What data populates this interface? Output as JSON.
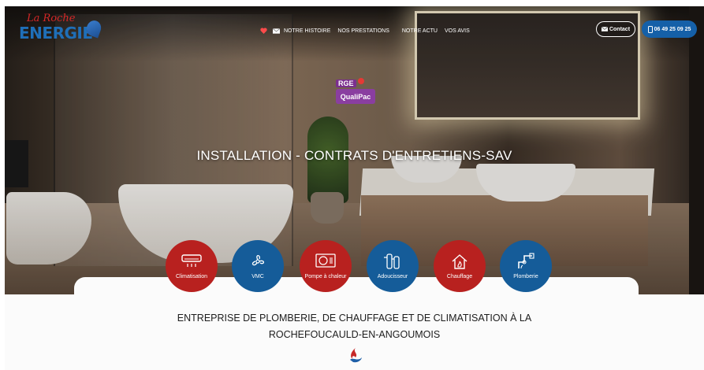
{
  "brand": {
    "logo_line1": "La Roche",
    "logo_line2": "ENERGIE"
  },
  "nav": {
    "items": [
      "NOTRE HISTOIRE",
      "NOS PRESTATIONS",
      "NOTRE ACTU",
      "VOS AVIS"
    ]
  },
  "header": {
    "contact_label": "Contact",
    "phone_label": "06 49 25 09 25"
  },
  "certification": {
    "top": "RGE",
    "bottom": "QualiPac"
  },
  "hero": {
    "tagline": "INSTALLATION - CONTRATS D'ENTRETIENS-SAV"
  },
  "services": [
    {
      "label": "Climatisation",
      "icon": "air-conditioner-icon",
      "color": "#b8211f"
    },
    {
      "label": "VMC",
      "icon": "fan-icon",
      "color": "#155c99"
    },
    {
      "label": "Pompe à chaleur",
      "icon": "heat-pump-icon",
      "color": "#b8211f"
    },
    {
      "label": "Adoucisseur",
      "icon": "water-softener-icon",
      "color": "#155c99"
    },
    {
      "label": "Chauffage",
      "icon": "house-heating-icon",
      "color": "#b8211f"
    },
    {
      "label": "Plomberie",
      "icon": "pipes-icon",
      "color": "#155c99"
    }
  ],
  "main": {
    "heading_line1": "ENTREPRISE DE PLOMBERIE, DE CHAUFFAGE ET DE CLIMATISATION À LA",
    "heading_line2": "ROCHEFOUCAULD-EN-ANGOUMOIS"
  },
  "colors": {
    "brand_red": "#b8211f",
    "brand_blue": "#155c99",
    "phone_button": "#1560a8"
  }
}
